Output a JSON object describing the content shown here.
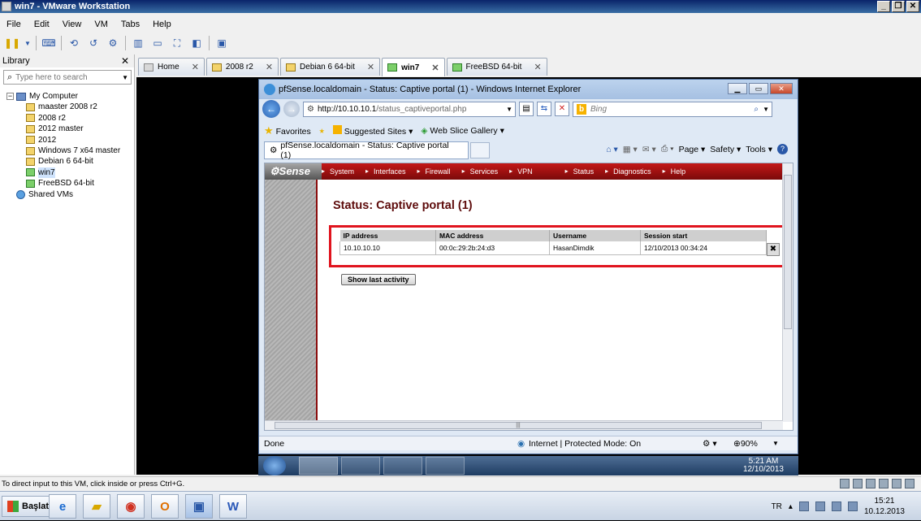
{
  "vmware": {
    "title": "win7 - VMware Workstation",
    "menu": [
      "File",
      "Edit",
      "View",
      "VM",
      "Tabs",
      "Help"
    ],
    "library": {
      "title": "Library",
      "search_placeholder": "Type here to search",
      "root": "My Computer",
      "vms": [
        "maaster 2008 r2",
        "2008 r2",
        "2012 master",
        "2012",
        "Windows 7 x64 master",
        "Debian 6 64-bit",
        "win7",
        "FreeBSD 64-bit"
      ],
      "shared": "Shared VMs"
    },
    "tabs": [
      {
        "label": "Home"
      },
      {
        "label": "2008 r2"
      },
      {
        "label": "Debian 6 64-bit"
      },
      {
        "label": "win7"
      },
      {
        "label": "FreeBSD 64-bit"
      }
    ],
    "status_text": "To direct input to this VM, click inside or press Ctrl+G."
  },
  "ie": {
    "title": "pfSense.localdomain - Status: Captive portal (1) - Windows Internet Explorer",
    "url_host": "http://10.10.10.1",
    "url_path": "/status_captiveportal.php",
    "search_engine": "Bing",
    "favorites": "Favorites",
    "suggested_sites": "Suggested Sites",
    "web_slice": "Web Slice Gallery",
    "tab_title": "pfSense.localdomain - Status: Captive portal (1)",
    "commands": [
      "Page",
      "Safety",
      "Tools"
    ],
    "status_left": "Done",
    "status_zone": "Internet | Protected Mode: On",
    "zoom": "90%"
  },
  "pfsense": {
    "logo": "Sense",
    "menu": [
      "System",
      "Interfaces",
      "Firewall",
      "Services",
      "VPN",
      "Status",
      "Diagnostics",
      "Help"
    ],
    "heading": "Status: Captive portal (1)",
    "table": {
      "headers": [
        "IP address",
        "MAC address",
        "Username",
        "Session start"
      ],
      "rows": [
        [
          "10.10.10.10",
          "00:0c:29:2b:24:d3",
          "HasanDimdik",
          "12/10/2013 00:34:24"
        ]
      ]
    },
    "button": "Show last activity"
  },
  "guest_clock": {
    "time": "5:21 AM",
    "date": "12/10/2013"
  },
  "host": {
    "start_label": "Başlat",
    "lang": "TR",
    "time": "15:21",
    "date": "10.12.2013"
  }
}
